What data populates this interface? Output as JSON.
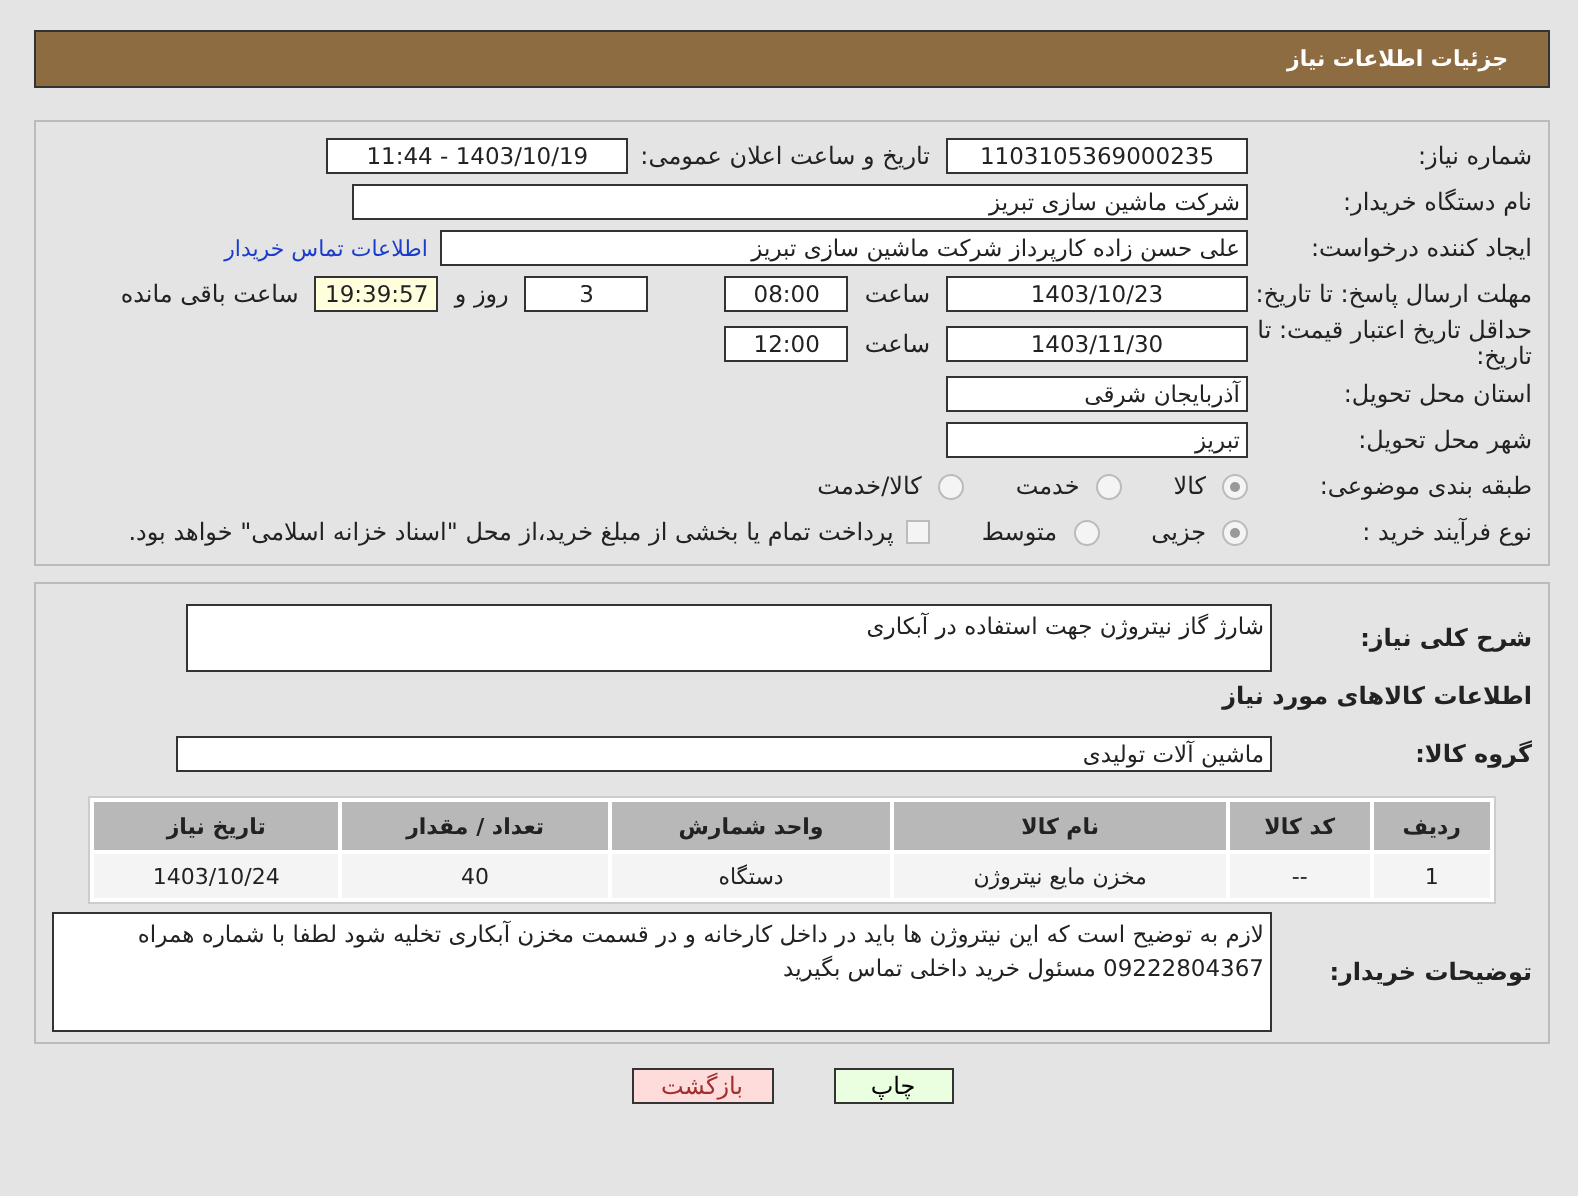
{
  "header": {
    "title": "جزئیات اطلاعات نیاز"
  },
  "form": {
    "need_number": {
      "label": "شماره نیاز:",
      "value": "1103105369000235"
    },
    "announce": {
      "label": "تاریخ و ساعت اعلان عمومی:",
      "value": "1403/10/19 - 11:44"
    },
    "buyer_org": {
      "label": "نام دستگاه خریدار:",
      "value": "شرکت ماشین سازی تبریز"
    },
    "requester": {
      "label": "ایجاد کننده درخواست:",
      "value": "علی حسن زاده کارپرداز شرکت ماشین سازی تبریز",
      "link": "اطلاعات تماس خریدار"
    },
    "deadline": {
      "label": "مهلت ارسال پاسخ: تا تاریخ:",
      "date": "1403/10/23",
      "time_label": "ساعت",
      "time": "08:00",
      "days": "3",
      "days_label": "روز و",
      "remaining": "19:39:57",
      "remaining_label": "ساعت باقی مانده"
    },
    "validity": {
      "label": "حداقل تاریخ اعتبار قیمت: تا تاریخ:",
      "date": "1403/11/30",
      "time_label": "ساعت",
      "time": "12:00"
    },
    "province": {
      "label": "استان محل تحویل:",
      "value": "آذربایجان شرقی"
    },
    "city": {
      "label": "شهر محل تحویل:",
      "value": "تبریز"
    },
    "category": {
      "label": "طبقه بندی موضوعی:",
      "options": [
        {
          "label": "کالا",
          "selected": true
        },
        {
          "label": "خدمت",
          "selected": false
        },
        {
          "label": "کالا/خدمت",
          "selected": false
        }
      ]
    },
    "process": {
      "label": "نوع فرآیند خرید :",
      "options": [
        {
          "label": "جزیی",
          "selected": true
        },
        {
          "label": "متوسط",
          "selected": false
        }
      ],
      "payment": {
        "label": "پرداخت تمام یا بخشی از مبلغ خرید،از محل \"اسناد خزانه اسلامی\" خواهد بود.",
        "checked": false
      }
    }
  },
  "description": {
    "label": "شرح کلی نیاز:",
    "value": "شارژ گاز نیتروژن جهت استفاده در آبکاری"
  },
  "goods_title": "اطلاعات کالاهای مورد نیاز",
  "goods_group": {
    "label": "گروه کالا:",
    "value": "ماشین آلات تولیدی"
  },
  "table": {
    "columns": [
      "ردیف",
      "کد کالا",
      "نام کالا",
      "واحد شمارش",
      "تعداد / مقدار",
      "تاریخ نیاز"
    ],
    "rows": [
      [
        "1",
        "--",
        "مخزن مایع نیتروژن",
        "دستگاه",
        "40",
        "1403/10/24"
      ]
    ]
  },
  "buyer_notes": {
    "label": "توضیحات خریدار:",
    "value": "لازم به توضیح است که این نیتروژن ها باید در داخل کارخانه و در قسمت مخزن آبکاری تخلیه شود لطفا با شماره همراه 09222804367 مسئول خرید داخلی تماس بگیرید"
  },
  "buttons": [
    {
      "label": "چاپ",
      "kind": "print"
    },
    {
      "label": "بازگشت",
      "kind": "back"
    }
  ]
}
